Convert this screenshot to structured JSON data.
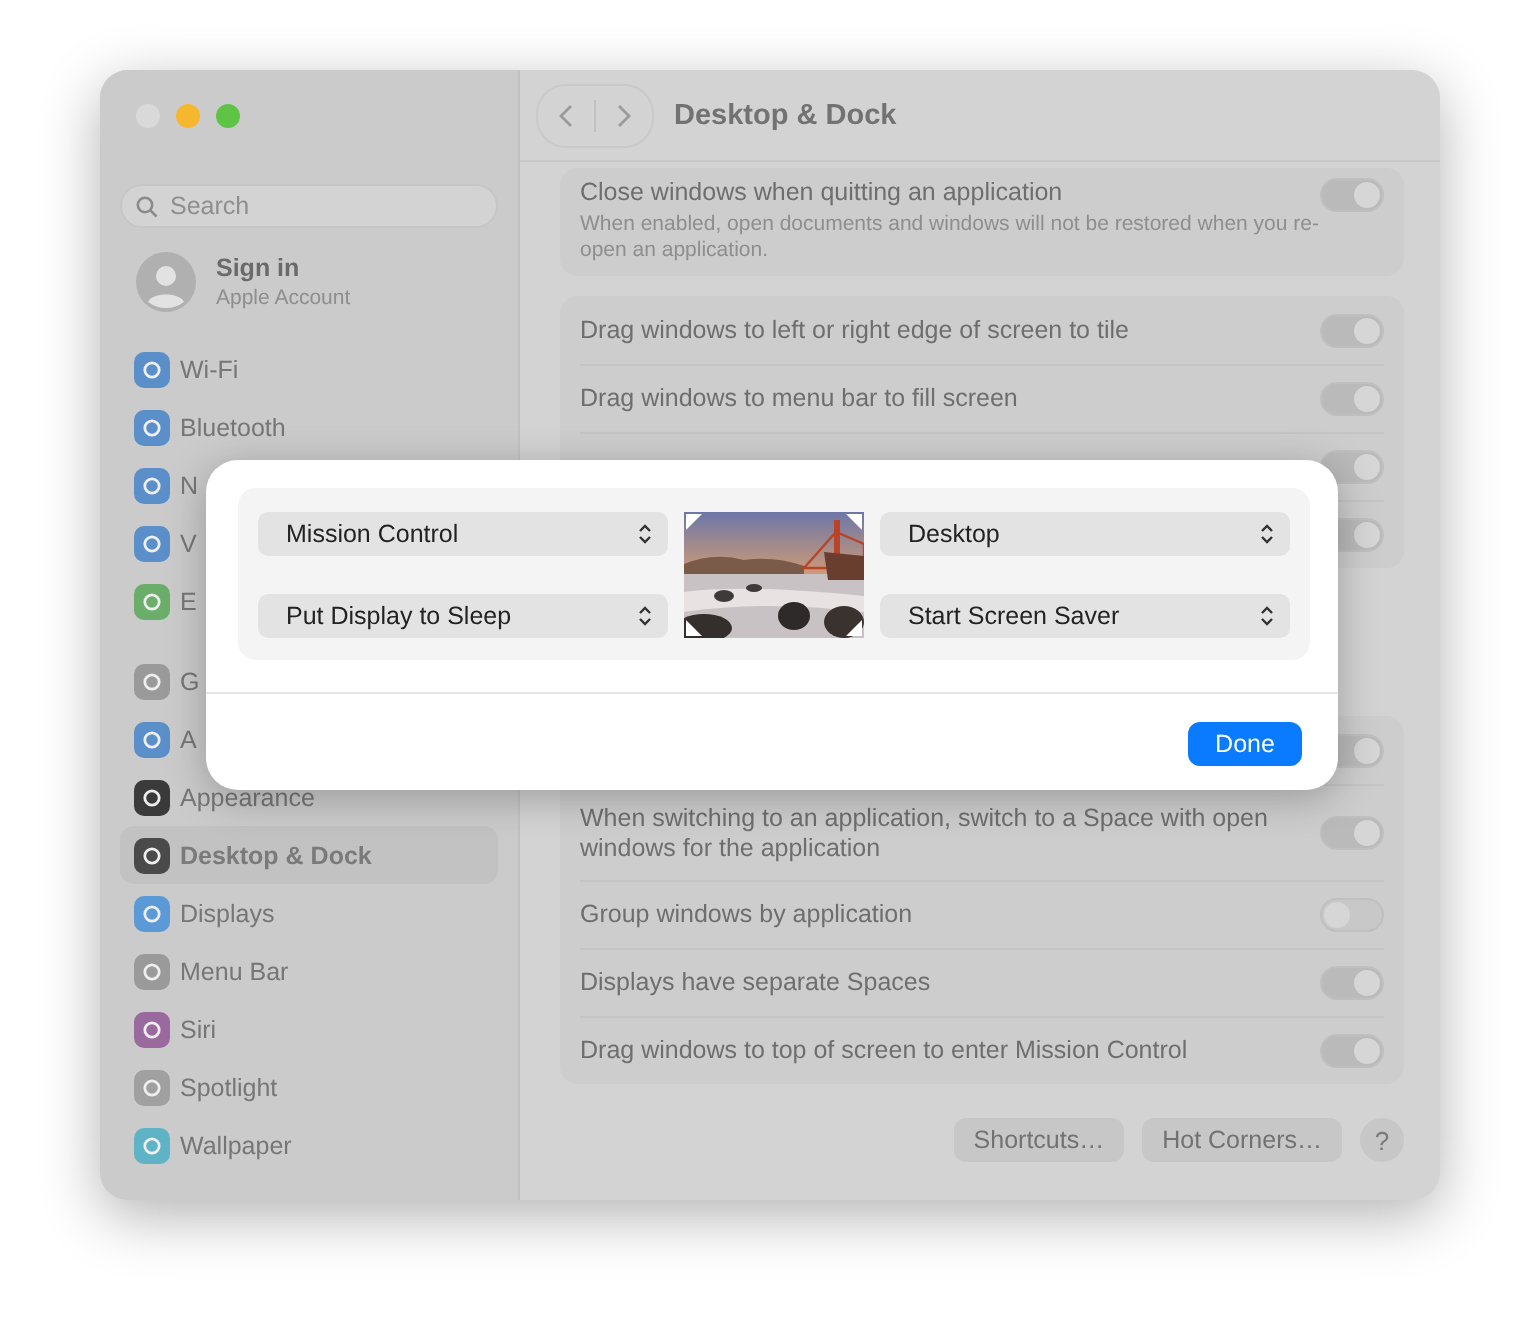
{
  "window": {
    "title": "Desktop & Dock"
  },
  "sidebar": {
    "search": {
      "placeholder": "Search"
    },
    "account": {
      "name": "Sign in",
      "subtitle": "Apple Account"
    },
    "sections": [
      {
        "items": [
          {
            "label": "Wi-Fi",
            "selected": false,
            "color": "#5b8fc9"
          },
          {
            "label": "Bluetooth",
            "selected": false,
            "color": "#5b8fc9"
          },
          {
            "label": "N",
            "selected": false,
            "color": "#5b8fc9"
          },
          {
            "label": "V",
            "selected": false,
            "color": "#5b8fc9"
          },
          {
            "label": "E",
            "selected": false,
            "color": "#6aae6a"
          }
        ]
      },
      {
        "items": [
          {
            "label": "G",
            "selected": false,
            "color": "#9a9a9a"
          },
          {
            "label": "A",
            "selected": false,
            "color": "#5b8fc9"
          },
          {
            "label": "Appearance",
            "selected": false,
            "color": "#3a3a3a"
          },
          {
            "label": "Desktop & Dock",
            "selected": true,
            "color": "#4a4a4a"
          },
          {
            "label": "Displays",
            "selected": false,
            "color": "#5b9ad6"
          },
          {
            "label": "Menu Bar",
            "selected": false,
            "color": "#9a9a9a"
          },
          {
            "label": "Siri",
            "selected": false,
            "color": "#9a6a9e"
          },
          {
            "label": "Spotlight",
            "selected": false,
            "color": "#a0a0a0"
          },
          {
            "label": "Wallpaper",
            "selected": false,
            "color": "#5fb3c6"
          }
        ]
      }
    ]
  },
  "content": {
    "cards": [
      {
        "rows": [
          {
            "label": "Close windows when quitting an application",
            "description": "When enabled, open documents and windows will not be restored when you re-open an application.",
            "on": true
          }
        ]
      },
      {
        "rows": [
          {
            "label": "Drag windows to left or right edge of screen to tile",
            "on": true
          },
          {
            "label": "Drag windows to menu bar to fill screen",
            "on": true
          },
          {
            "on": true
          },
          {
            "on": true
          }
        ]
      },
      {
        "rows": [
          {
            "on": true
          },
          {
            "label": "When switching to an application, switch to a Space with open windows for the application",
            "on": true
          },
          {
            "label": "Group windows by application",
            "on": false
          },
          {
            "label": "Displays have separate Spaces",
            "on": true
          },
          {
            "label": "Drag windows to top of screen to enter Mission Control",
            "on": true
          }
        ]
      }
    ],
    "buttons": [
      "Shortcuts…",
      "Hot Corners…"
    ],
    "help": "?"
  },
  "sheet": {
    "corners": [
      {
        "value": "Mission Control"
      },
      {
        "value": "Desktop"
      },
      {
        "value": "Put Display to Sleep"
      },
      {
        "value": "Start Screen Saver"
      }
    ],
    "done": "Done"
  }
}
